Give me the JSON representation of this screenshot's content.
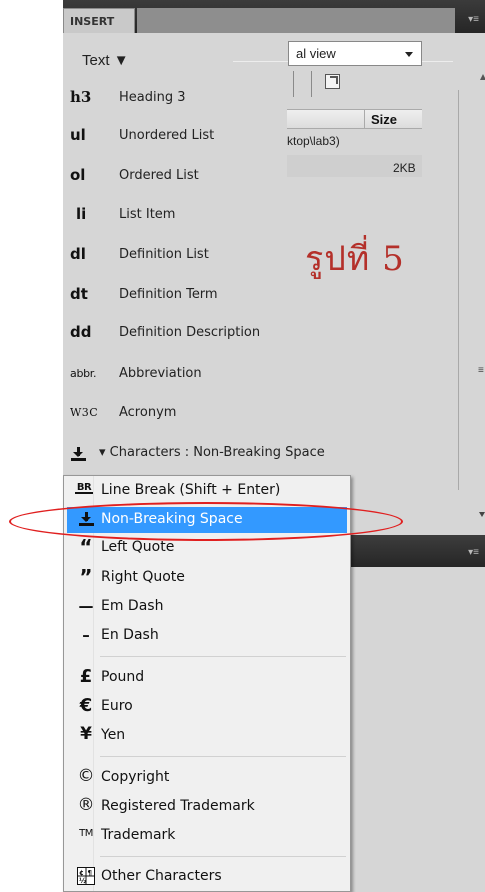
{
  "insert_panel": {
    "tab_label": "INSERT",
    "category": "Text",
    "items": [
      {
        "icon": "h3",
        "label": "Heading 3"
      },
      {
        "icon": "ul",
        "label": "Unordered List"
      },
      {
        "icon": "ol",
        "label": "Ordered List"
      },
      {
        "icon": "li",
        "label": "List Item"
      },
      {
        "icon": "dl",
        "label": "Definition List"
      },
      {
        "icon": "dt",
        "label": "Definition Term"
      },
      {
        "icon": "dd",
        "label": "Definition Description"
      },
      {
        "icon": "abbr.",
        "label": "Abbreviation"
      },
      {
        "icon": "W3C",
        "label": "Acronym"
      },
      {
        "icon": "non-breaking-space-icon",
        "label": "▾ Characters : Non-Breaking Space"
      }
    ],
    "caption": "รูปที่ 5"
  },
  "files_panel": {
    "view_select": "al view",
    "size_header": "Size",
    "path_text": "ktop\\lab3)",
    "size_value": "2KB"
  },
  "characters_menu": {
    "items": [
      {
        "icon": "BR",
        "label": "Line Break (Shift + Enter)"
      },
      {
        "icon": "non-breaking-space-icon",
        "label": "Non-Breaking Space",
        "selected": true
      },
      {
        "icon": "“",
        "label": "Left Quote"
      },
      {
        "icon": "”",
        "label": "Right Quote"
      },
      {
        "icon": "—",
        "label": "Em Dash"
      },
      {
        "icon": "–",
        "label": "En Dash"
      },
      {
        "icon": "£",
        "label": "Pound"
      },
      {
        "icon": "€",
        "label": "Euro"
      },
      {
        "icon": "¥",
        "label": "Yen"
      },
      {
        "icon": "©",
        "label": "Copyright"
      },
      {
        "icon": "®",
        "label": "Registered Trademark"
      },
      {
        "icon": "TM",
        "label": "Trademark"
      },
      {
        "icon": "other-characters-icon",
        "label": "Other Characters"
      }
    ]
  }
}
